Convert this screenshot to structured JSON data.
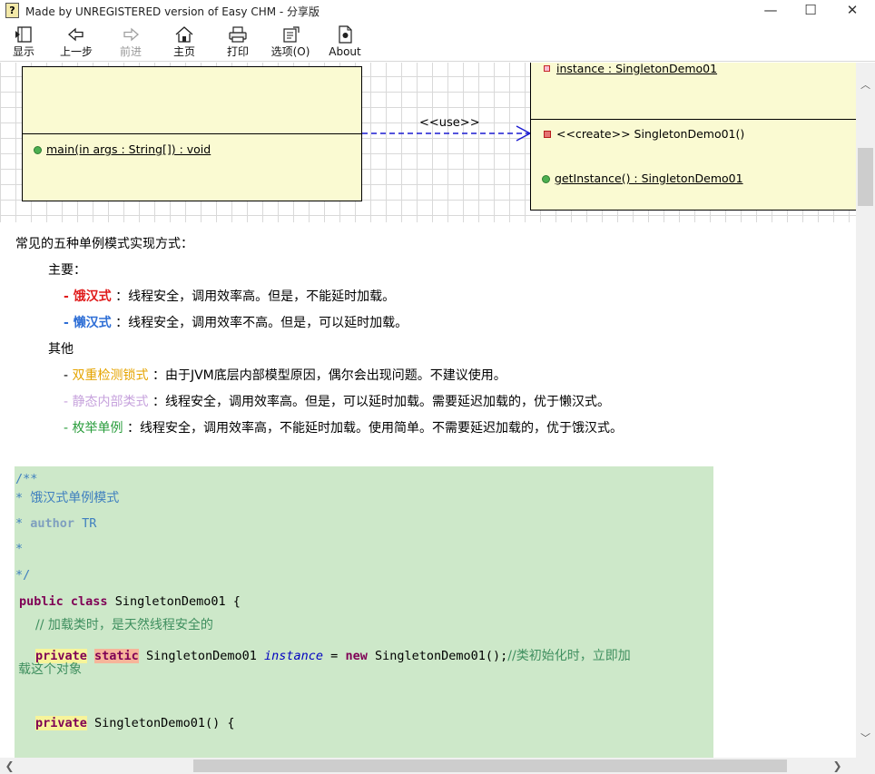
{
  "window": {
    "title": "Made by UNREGISTERED version of Easy CHM - 分享版",
    "icon": "help-file-icon",
    "controls": {
      "minimize": "—",
      "maximize": "☐",
      "close": "✕"
    }
  },
  "toolbar": {
    "items": [
      {
        "label": "显示",
        "icon": "show-pane-icon",
        "enabled": true
      },
      {
        "label": "上一步",
        "icon": "back-arrow-icon",
        "enabled": true
      },
      {
        "label": "前进",
        "icon": "forward-arrow-icon",
        "enabled": false
      },
      {
        "label": "主页",
        "icon": "home-icon",
        "enabled": true
      },
      {
        "label": "打印",
        "icon": "printer-icon",
        "enabled": true
      },
      {
        "label": "选项(O)",
        "icon": "options-icon",
        "enabled": true
      },
      {
        "label": "About",
        "icon": "document-icon",
        "enabled": true
      }
    ]
  },
  "diagram": {
    "left_class": {
      "method": "main(in args : String[]) : void"
    },
    "relation_label": "<<use>>",
    "right_class": {
      "attribute": "instance : SingletonDemo01",
      "constructor": "<<create>> SingletonDemo01()",
      "method": "getInstance() : SingletonDemo01"
    }
  },
  "article": {
    "intro": "常见的五种单例模式实现方式：",
    "main_heading": "主要：",
    "items_main": [
      {
        "dash": "- ",
        "name": "饿汉式",
        "desc": " ：线程安全，调用效率高。但是，不能延时加载。"
      },
      {
        "dash": "- ",
        "name": "懒汉式",
        "desc": " ：线程安全，调用效率不高。但是，可以延时加载。"
      }
    ],
    "other_heading": "其他",
    "items_other": [
      {
        "dash": "-  ",
        "name": "双重检测锁式",
        "desc": " ：由于JVM底层内部模型原因，偶尔会出现问题。不建议使用。"
      },
      {
        "dash": "- ",
        "name": "静态内部类式",
        "desc": " ：线程安全，调用效率高。但是，可以延时加载。需要延迟加载的，优于懒汉式。"
      },
      {
        "dash": "- ",
        "name": "枚举单例",
        "desc": " ：线程安全，调用效率高，不能延时加载。使用简单。不需要延迟加载的，优于饿汉式。"
      }
    ]
  },
  "code": {
    "l1": "/**",
    "l2_star": " * ",
    "l2_text": "饿汉式单例模式",
    "l3_star": " * ",
    "l3_tag": "author",
    "l3_val": " TR",
    "l4": " *",
    "l5": " */",
    "l6_kw1": "public",
    "l6_kw2": "class",
    "l6_rest": " SingletonDemo01 {",
    "l7_comment": "// 加载类时，是天然线程安全的",
    "l8_private": "private",
    "l8_static": "static",
    "l8_type": " SingletonDemo01 ",
    "l8_field": "instance",
    "l8_eq": " = ",
    "l8_new": "new",
    "l8_ctor": " SingletonDemo01();",
    "l8_comment": "//类初始化时，立即加",
    "l8_wrap": "载这个对象",
    "l9_private": "private",
    "l9_rest": "  SingletonDemo01() {"
  },
  "colors": {
    "uml_fill": "#fafad2",
    "code_bg": "#cde8c9",
    "hungry": "#e01b1b",
    "lazy": "#2f6fd6",
    "double_check": "#e5a400",
    "static_inner": "#c7a3dd",
    "enum": "#2a9d3c"
  }
}
